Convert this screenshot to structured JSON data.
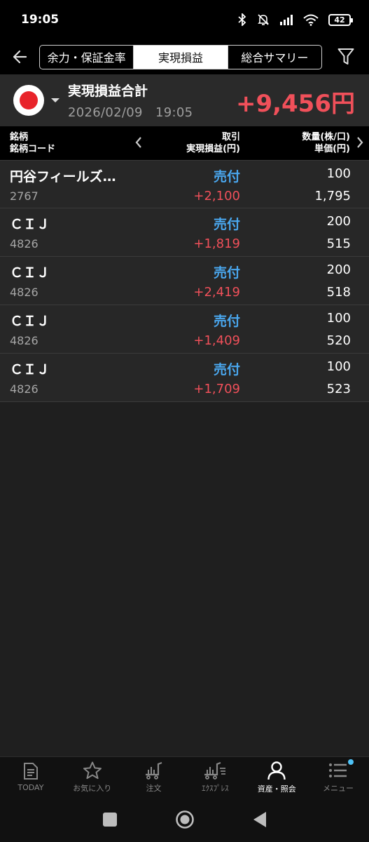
{
  "status": {
    "time": "19:05",
    "battery": "42"
  },
  "header": {
    "tabs": [
      {
        "label": "余力・保証金率",
        "active": false
      },
      {
        "label": "実現損益",
        "active": true
      },
      {
        "label": "総合サマリー",
        "active": false
      }
    ]
  },
  "summary": {
    "title": "実現損益合計",
    "datetime": "2026/02/09　19:05",
    "total": "+9,456円"
  },
  "columns": {
    "left1": "銘柄",
    "left2": "銘柄コード",
    "mid1": "取引",
    "mid2": "実現損益(円)",
    "right1": "数量(株/口)",
    "right2": "単価(円)"
  },
  "rows": [
    {
      "name": "円谷フィールズ…",
      "code": "2767",
      "side": "売付",
      "pl": "+2,100",
      "qty": "100",
      "price": "1,795"
    },
    {
      "name": "ＣＩＪ",
      "code": "4826",
      "side": "売付",
      "pl": "+1,819",
      "qty": "200",
      "price": "515"
    },
    {
      "name": "ＣＩＪ",
      "code": "4826",
      "side": "売付",
      "pl": "+2,419",
      "qty": "200",
      "price": "518"
    },
    {
      "name": "ＣＩＪ",
      "code": "4826",
      "side": "売付",
      "pl": "+1,409",
      "qty": "100",
      "price": "520"
    },
    {
      "name": "ＣＩＪ",
      "code": "4826",
      "side": "売付",
      "pl": "+1,709",
      "qty": "100",
      "price": "523"
    }
  ],
  "nav": [
    {
      "label": "TODAY",
      "icon": "document-icon",
      "active": false
    },
    {
      "label": "お気に入り",
      "icon": "star-icon",
      "active": false
    },
    {
      "label": "注文",
      "icon": "cart-icon",
      "active": false
    },
    {
      "label": "ｴｸｽﾌﾟﾚｽ",
      "icon": "fast-cart-icon",
      "active": false
    },
    {
      "label": "資産・照会",
      "icon": "person-icon",
      "active": true
    },
    {
      "label": "メニュー",
      "icon": "menu-icon",
      "active": false
    }
  ],
  "colors": {
    "profit": "#f0505a",
    "side": "#4aa8f0",
    "accent_badge": "#4fc3f7"
  }
}
